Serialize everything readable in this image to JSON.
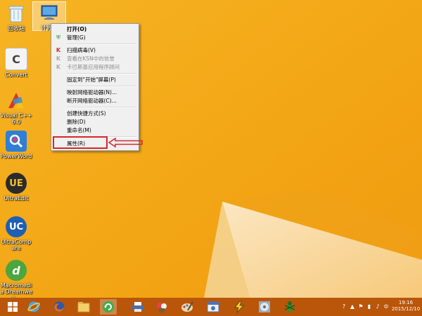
{
  "desktop_icons": [
    {
      "name": "recycle-bin",
      "label": "回收站"
    },
    {
      "name": "computer",
      "label": "计算机"
    },
    {
      "name": "convert",
      "label": "Convert"
    },
    {
      "name": "visual-cpp",
      "label": "Visual C++ 6.0"
    },
    {
      "name": "powerword",
      "label": "PowerWord"
    },
    {
      "name": "ultraedit",
      "label": "UltraEdit"
    },
    {
      "name": "ultracompare",
      "label": "UltraCompare"
    },
    {
      "name": "dreamweaver",
      "label": "Macromedia Dreamwea..."
    }
  ],
  "context_menu": {
    "items": {
      "open": "打开(O)",
      "manage": "管理(G)",
      "scan": "扫描病毒(V)",
      "ksn": "查看在KSN中的信誉",
      "kaspersky": "卡巴斯基应用程序顾问",
      "pin_start": "固定到\"开始\"屏幕(P)",
      "map_drive": "映射网络驱动器(N)...",
      "disconnect_drive": "断开网络驱动器(C)...",
      "create_shortcut": "创建快捷方式(S)",
      "delete": "删除(D)",
      "rename": "重命名(M)",
      "properties": "属性(R)"
    }
  },
  "annotation": {
    "color": "#d7262c"
  },
  "taskbar": {
    "clock_time": "19:16",
    "clock_date": "2015/12/10",
    "apps": [
      "start",
      "internet-explorer",
      "firefox",
      "file-explorer",
      "refresh-app",
      "printer",
      "paint",
      "image-app",
      "app-window",
      "lightning-app",
      "cd-app",
      "bug-app"
    ]
  },
  "colors": {
    "desktop": "#f3a715",
    "taskbar": "#b9560a"
  }
}
